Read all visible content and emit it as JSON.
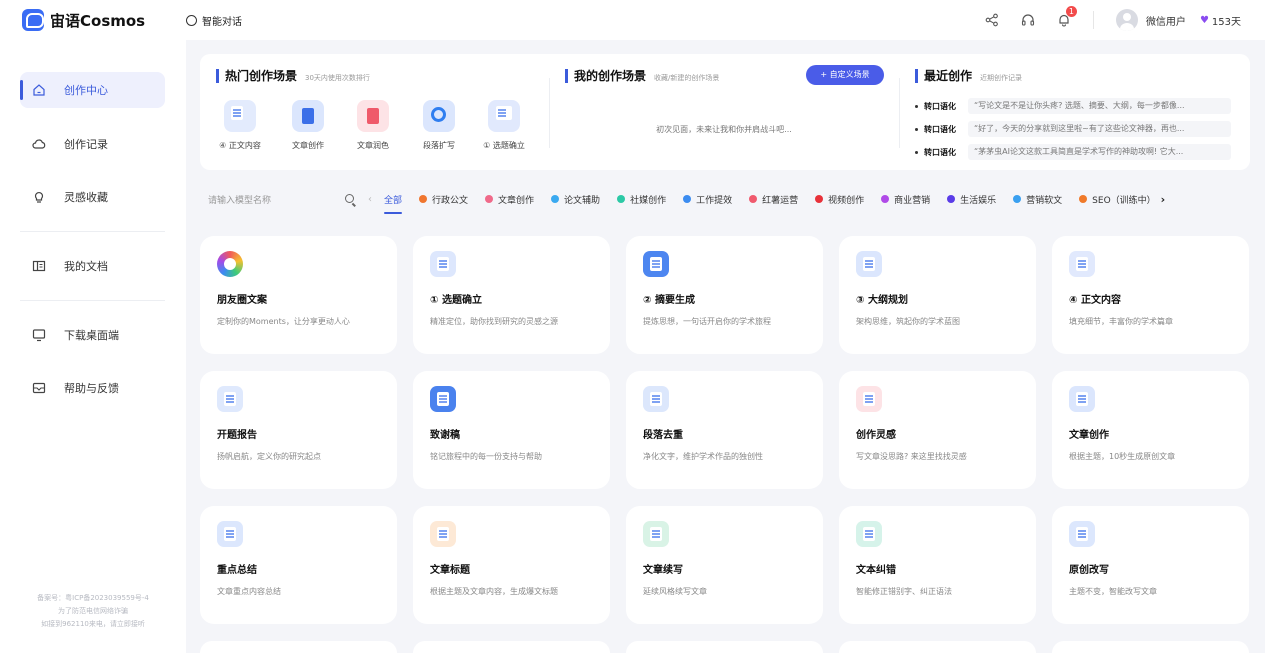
{
  "app": {
    "name": "宙语Cosmos",
    "tab": "智能对话"
  },
  "header": {
    "user_name": "微信用户",
    "vip_days": "153天",
    "notification_count": "1"
  },
  "sidebar": {
    "items": [
      {
        "label": "创作中心",
        "icon": "home-icon",
        "active": true
      },
      {
        "label": "创作记录",
        "icon": "cloud-icon"
      },
      {
        "label": "灵感收藏",
        "icon": "lightbulb-icon"
      },
      {
        "label": "我的文档",
        "icon": "book-icon"
      },
      {
        "label": "下载桌面端",
        "icon": "monitor-icon"
      },
      {
        "label": "帮助与反馈",
        "icon": "mail-icon"
      }
    ],
    "footer": {
      "line1": "备案号：粤ICP备2023039559号-4",
      "line2": "为了防范电信网络诈骗",
      "line3": "如接到962110来电，请立即接听"
    }
  },
  "hot": {
    "title": "热门创作场景",
    "subtitle": "30天内使用次数排行",
    "items": [
      {
        "label": "④ 正文内容",
        "color": "#4a7cf0"
      },
      {
        "label": "文章创作",
        "color": "#3b6fe8"
      },
      {
        "label": "文章润色",
        "color": "#ef5a6a"
      },
      {
        "label": "段落扩写",
        "color": "#2f7ef0"
      },
      {
        "label": "① 选题确立",
        "color": "#6b8ef2"
      }
    ]
  },
  "mine": {
    "title": "我的创作场景",
    "subtitle": "收藏/新建的创作场景",
    "button": "+ 自定义场景",
    "empty": "初次见面，未来让我和你并肩战斗吧..."
  },
  "recent": {
    "title": "最近创作",
    "subtitle": "近期创作记录",
    "items": [
      {
        "tag": "转口语化",
        "text": "“写论文是不是让你头疼? 选题、摘要、大纲，每一步都像..."
      },
      {
        "tag": "转口语化",
        "text": "“好了，今天的分享就到这里啦~有了这些论文神器，再也..."
      },
      {
        "tag": "转口语化",
        "text": "“茅茅虫AI论文这款工具简直是学术写作的神助攻啊! 它大..."
      }
    ]
  },
  "filter": {
    "search_placeholder": "请输入模型名称",
    "chips": [
      {
        "label": "全部",
        "color": "",
        "active": true
      },
      {
        "label": "行政公文",
        "color": "#f0762f"
      },
      {
        "label": "文章创作",
        "color": "#f06a8a"
      },
      {
        "label": "论文辅助",
        "color": "#3aa9f0"
      },
      {
        "label": "社媒创作",
        "color": "#2cc9a6"
      },
      {
        "label": "工作提效",
        "color": "#3b8cf0"
      },
      {
        "label": "红薯运营",
        "color": "#f05a6e"
      },
      {
        "label": "视频创作",
        "color": "#e8323a"
      },
      {
        "label": "商业营销",
        "color": "#b04ae8"
      },
      {
        "label": "生活娱乐",
        "color": "#5a3ce8"
      },
      {
        "label": "营销软文",
        "color": "#3aa0f0"
      },
      {
        "label": "SEO（训练中）",
        "color": "#f07a2a"
      }
    ]
  },
  "cards": [
    {
      "title": "朋友圈文案",
      "desc": "定制你的Moments，让分享更动人心",
      "bg": "#ffffff",
      "ring": true
    },
    {
      "title": "① 选题确立",
      "desc": "精准定位，助你找到研究的灵感之源",
      "bg": "#dde7fd"
    },
    {
      "title": "② 摘要生成",
      "desc": "提炼思想，一句话开启你的学术旅程",
      "bg": "#4d86f0"
    },
    {
      "title": "③ 大纲规划",
      "desc": "架构思维，筑起你的学术蓝图",
      "bg": "#dbe6fd"
    },
    {
      "title": "④ 正文内容",
      "desc": "填充细节，丰富你的学术篇章",
      "bg": "#e1e9fd"
    },
    {
      "title": "开题报告",
      "desc": "扬帆启航，定义你的研究起点",
      "bg": "#dfe9fd"
    },
    {
      "title": "致谢稿",
      "desc": "铭记旅程中的每一份支持与帮助",
      "bg": "#4a82ee"
    },
    {
      "title": "段落去重",
      "desc": "净化文字，维护学术作品的独创性",
      "bg": "#dce7fc"
    },
    {
      "title": "创作灵感",
      "desc": "写文章没思路? 来这里找找灵感",
      "bg": "#fde3e6"
    },
    {
      "title": "文章创作",
      "desc": "根据主题，10秒生成原创文章",
      "bg": "#dbe6fd"
    },
    {
      "title": "重点总结",
      "desc": "文章重点内容总结",
      "bg": "#dce7fd"
    },
    {
      "title": "文章标题",
      "desc": "根据主题及文章内容，生成爆文标题",
      "bg": "#fde9d6"
    },
    {
      "title": "文章续写",
      "desc": "延续风格续写文章",
      "bg": "#d9f3e6"
    },
    {
      "title": "文本纠错",
      "desc": "智能修正错别字、纠正语法",
      "bg": "#d6f3ea"
    },
    {
      "title": "原创改写",
      "desc": "主题不变，智能改写文章",
      "bg": "#dce7fd"
    }
  ]
}
